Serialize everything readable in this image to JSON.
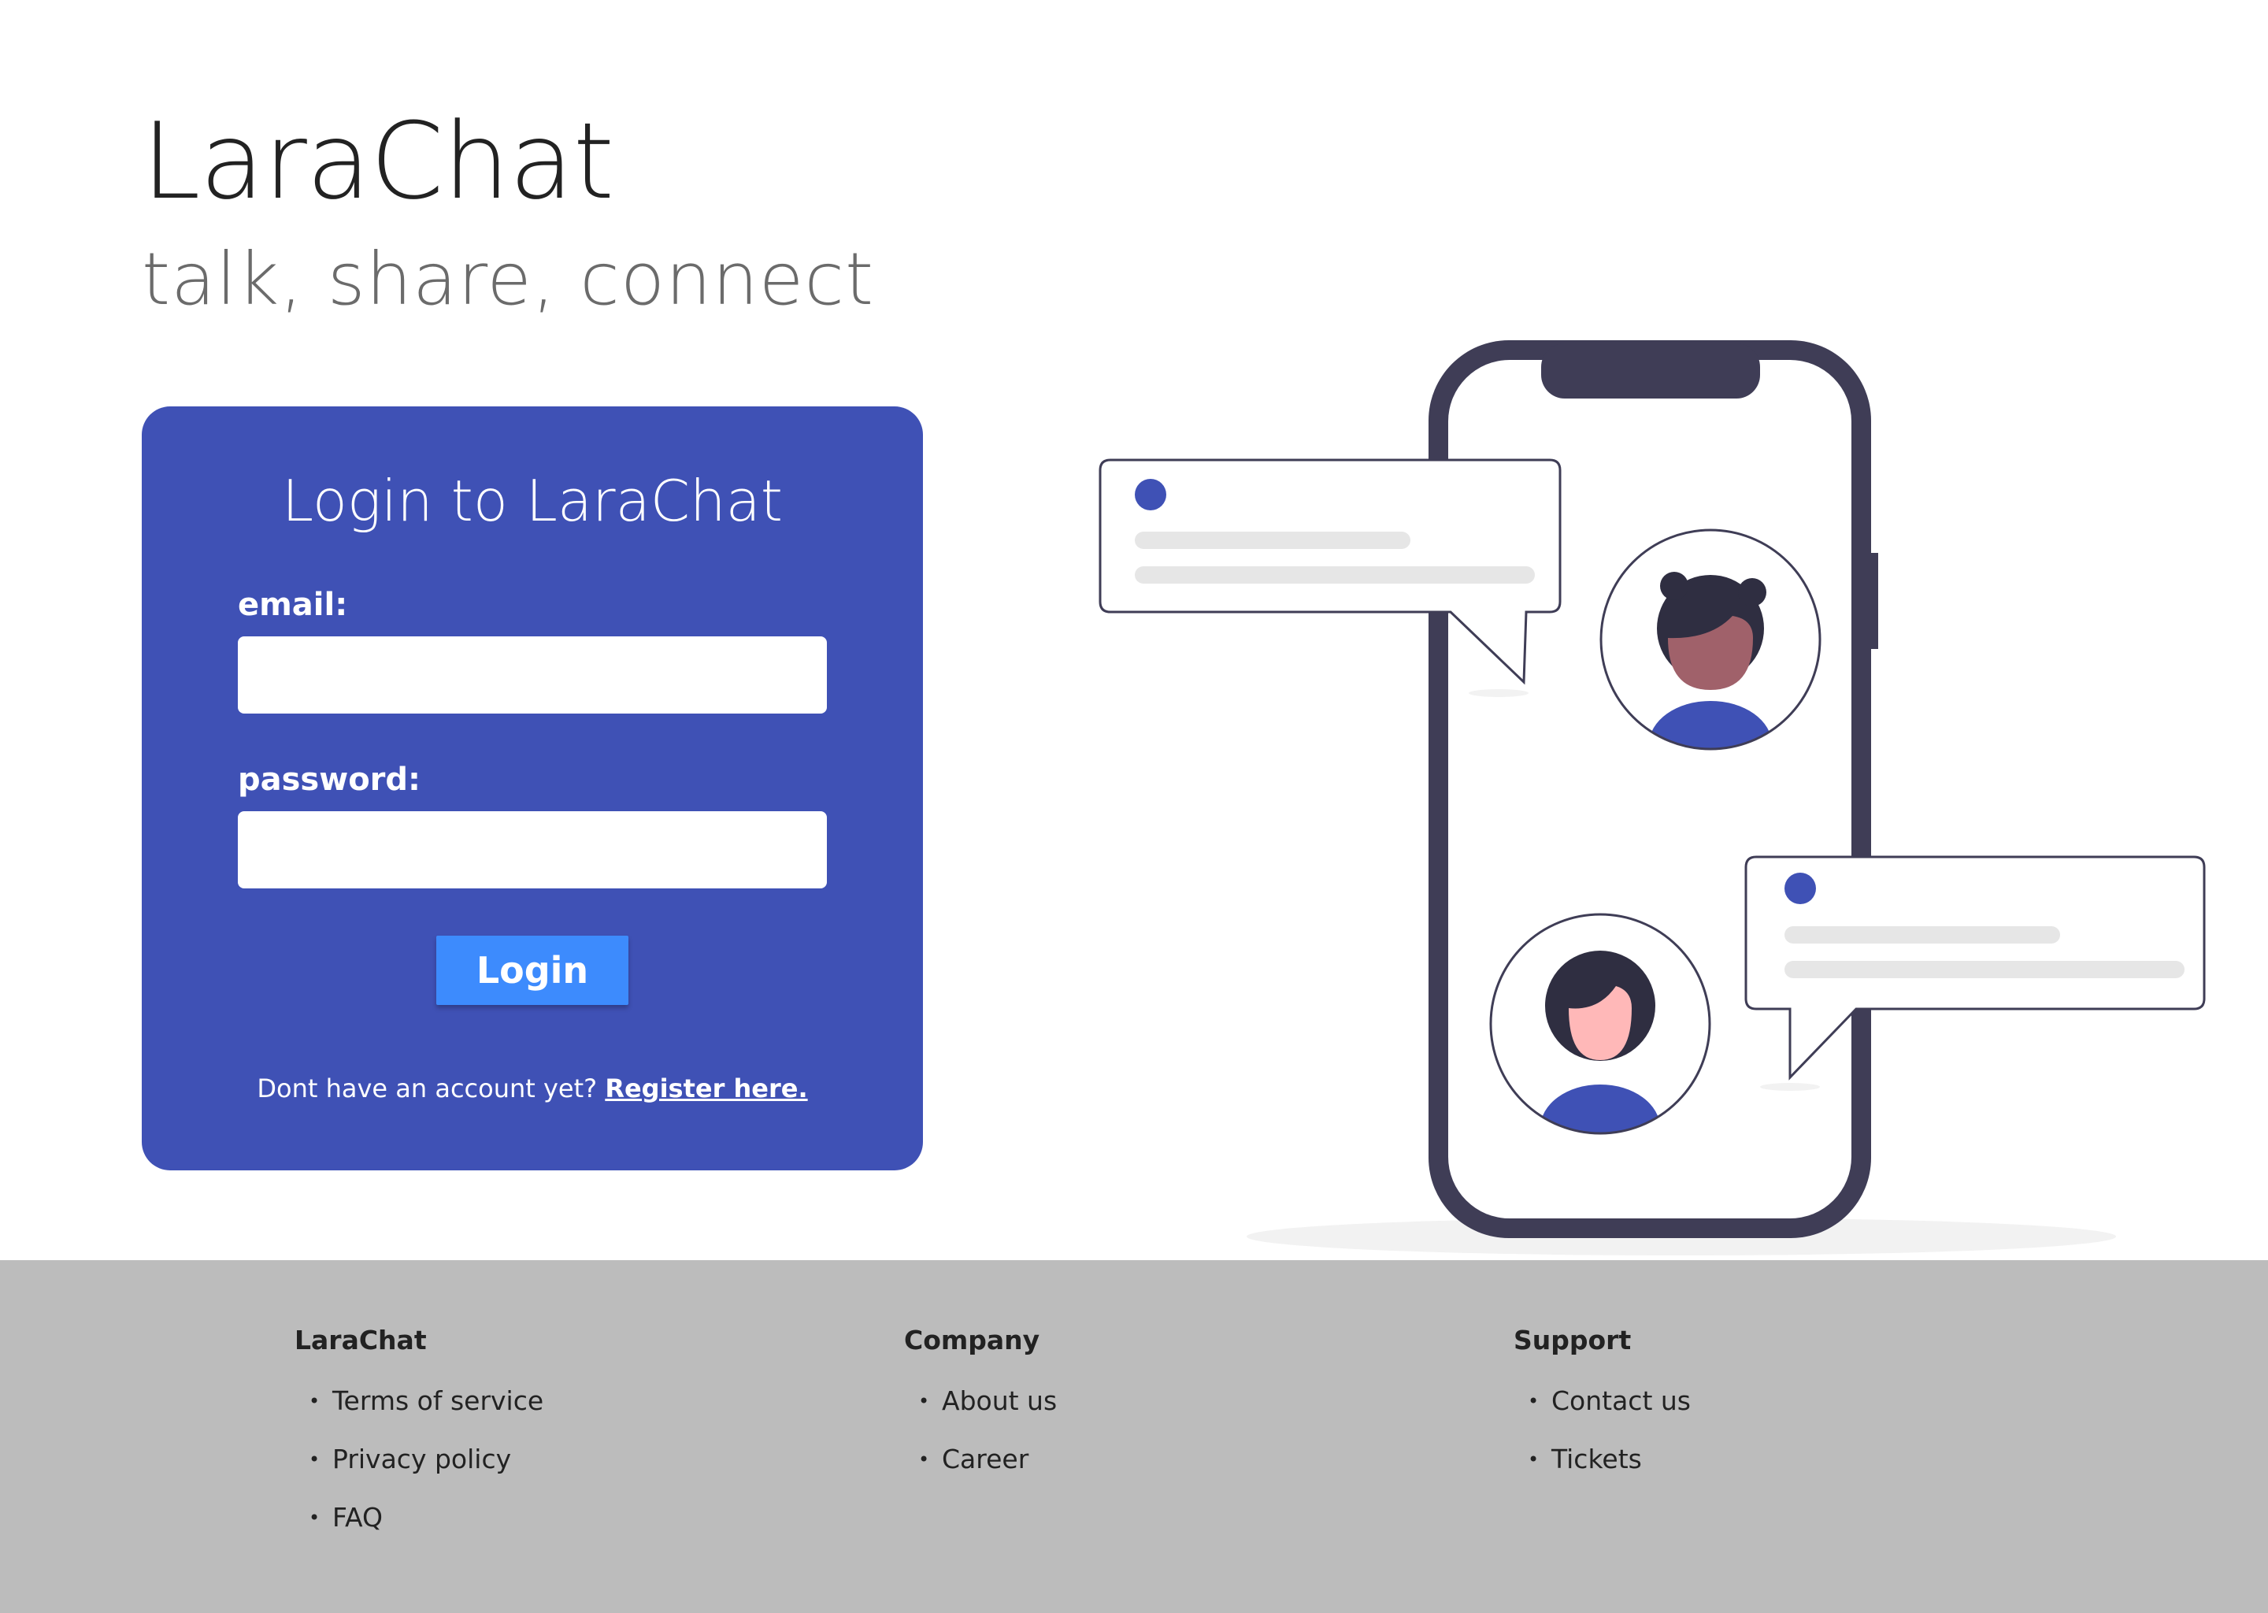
{
  "brand": {
    "title": "LaraChat",
    "tagline": "talk, share, connect"
  },
  "login": {
    "heading": "Login to LaraChat",
    "email_label": "email:",
    "email_value": "",
    "password_label": "password:",
    "password_value": "",
    "button_label": "Login",
    "register_prompt": "Dont have an account yet?",
    "register_link": "Register here."
  },
  "colors": {
    "card_background": "#3f51b5",
    "button_background": "#3d8bfd",
    "footer_background": "#bcbcbc",
    "phone_frame": "#3f3d56",
    "accent_dot": "#3f51b5"
  },
  "illustration": {
    "icons": [
      "phone-icon",
      "chat-bubble-icon",
      "avatar-woman-icon",
      "avatar-man-icon"
    ]
  },
  "footer": {
    "columns": [
      {
        "heading": "LaraChat",
        "items": [
          "Terms of service",
          "Privacy policy",
          "FAQ"
        ]
      },
      {
        "heading": "Company",
        "items": [
          "About us",
          "Career"
        ]
      },
      {
        "heading": "Support",
        "items": [
          "Contact us",
          "Tickets"
        ]
      }
    ]
  }
}
